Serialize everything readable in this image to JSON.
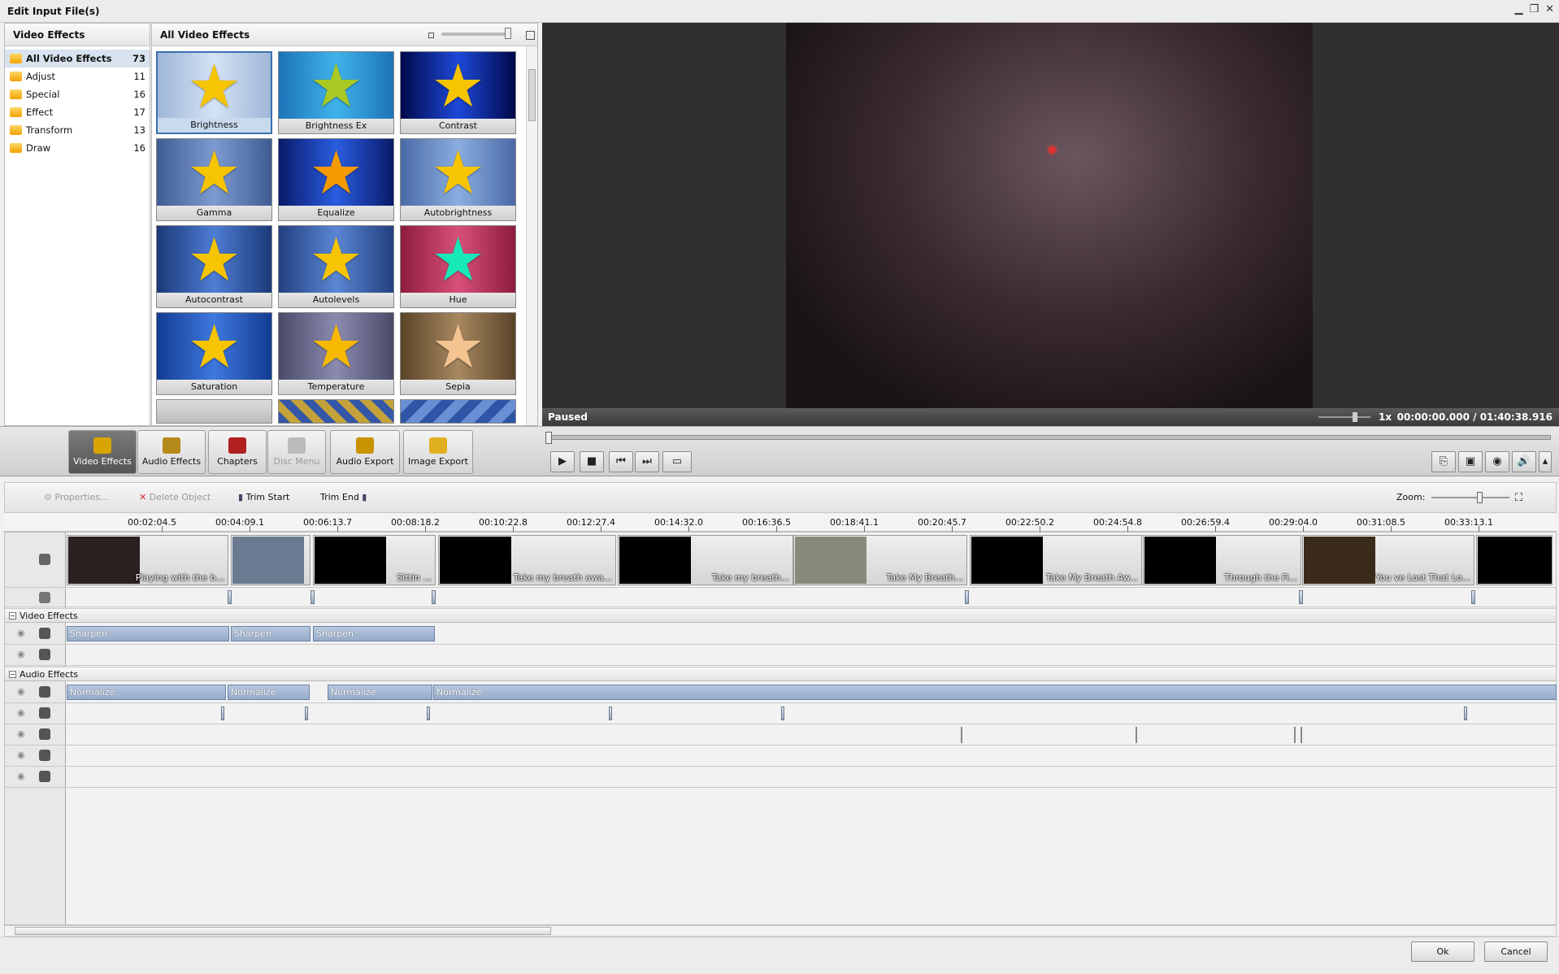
{
  "window": {
    "title": "Edit Input File(s)",
    "controls": [
      "minimize",
      "restore",
      "close"
    ]
  },
  "categories": {
    "header": "Video Effects",
    "items": [
      {
        "label": "All Video Effects",
        "count": "73",
        "selected": true
      },
      {
        "label": "Adjust",
        "count": "11"
      },
      {
        "label": "Special",
        "count": "16"
      },
      {
        "label": "Effect",
        "count": "17"
      },
      {
        "label": "Transform",
        "count": "13"
      },
      {
        "label": "Draw",
        "count": "16"
      }
    ]
  },
  "effects": {
    "header": "All Video Effects",
    "tiles": [
      {
        "label": "Brightness",
        "selected": true
      },
      {
        "label": "Brightness Ex"
      },
      {
        "label": "Contrast"
      },
      {
        "label": "Gamma"
      },
      {
        "label": "Equalize"
      },
      {
        "label": "Autobrightness"
      },
      {
        "label": "Autocontrast"
      },
      {
        "label": "Autolevels"
      },
      {
        "label": "Hue"
      },
      {
        "label": "Saturation"
      },
      {
        "label": "Temperature"
      },
      {
        "label": "Sepia"
      }
    ]
  },
  "player": {
    "status": "Paused",
    "speed": "1x",
    "time": "00:00:00.000 / 01:40:38.916"
  },
  "toolbar": {
    "buttons": [
      {
        "label": "Video Effects",
        "active": true
      },
      {
        "label": "Audio Effects"
      },
      {
        "label": "Chapters"
      },
      {
        "label": "Disc Menu",
        "disabled": true
      },
      {
        "label": "Audio Export"
      },
      {
        "label": "Image Export"
      }
    ],
    "transport": [
      "play-icon",
      "stop-icon",
      "previous-icon",
      "next-icon",
      "fullscreen-icon"
    ],
    "right_tools": [
      "export-frame-icon",
      "aspect-icon",
      "snapshot-icon",
      "volume-icon",
      "more-icon"
    ]
  },
  "timeline_tools": {
    "properties": "Properties...",
    "delete": "Delete Object",
    "trim_start": "Trim Start",
    "trim_end": "Trim End",
    "zoom": "Zoom:"
  },
  "ruler": [
    "00:02:04.5",
    "00:04:09.1",
    "00:06:13.7",
    "00:08:18.2",
    "00:10:22.8",
    "00:12:27.4",
    "00:14:32.0",
    "00:16:36.5",
    "00:18:41.1",
    "00:20:45.7",
    "00:22:50.2",
    "00:24:54.8",
    "00:26:59.4",
    "00:29:04.0",
    "00:31:08.5",
    "00:33:13.1"
  ],
  "clips": [
    {
      "name": "Playing with the b..."
    },
    {
      "name": ""
    },
    {
      "name": "Sittin ..."
    },
    {
      "name": "Take my breath awa..."
    },
    {
      "name": "Take my breath..."
    },
    {
      "name": "Take My Breath..."
    },
    {
      "name": "Take My Breath Aw..."
    },
    {
      "name": "Through the Fi..."
    },
    {
      "name": "You ve Lost That Lo..."
    },
    {
      "name": ""
    }
  ],
  "groups": {
    "video": "Video Effects",
    "audio": "Audio Effects"
  },
  "video_fx": [
    "Sharpen",
    "Sharpen",
    "Sharpen"
  ],
  "audio_fx": [
    "Normalize",
    "Normalize",
    "Normalize",
    "Normalize"
  ],
  "dialog": {
    "ok": "Ok",
    "cancel": "Cancel"
  }
}
